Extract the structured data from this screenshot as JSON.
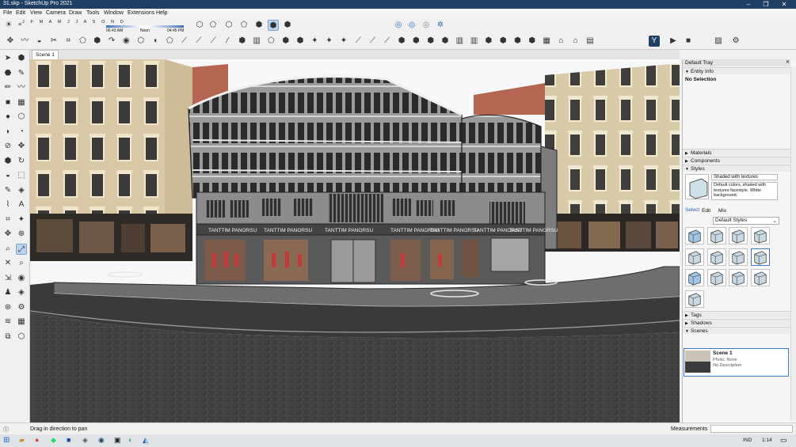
{
  "titlebar": {
    "title": "31.skp - SketchUp Pro 2021"
  },
  "menu": [
    "File",
    "Edit",
    "View",
    "Camera",
    "Draw",
    "Tools",
    "Window",
    "Extensions",
    "Help"
  ],
  "shadow": {
    "months": "J F M A M J J A S O N D",
    "sunrise": "06:43 AM",
    "noon": "Noon",
    "sunset": "04:45 PM"
  },
  "scene_tab": "Scene 1",
  "tray": {
    "title": "Default Tray",
    "entity_info": "Entity Info",
    "selection": "No Selection",
    "materials": "Materials",
    "components": "Components",
    "styles": "Styles",
    "style_name": "Shaded with textures",
    "style_desc": "Default colors, shaded with textures facestyle. White background.",
    "tab_select": "Select",
    "tab_edit": "Edit",
    "tab_mix": "Mix",
    "style_dropdown": "Default Styles",
    "tags": "Tags",
    "shadows": "Shadows",
    "scenes": "Scenes",
    "scene_name": "Scene 1",
    "scene_photo": "Photo: None",
    "scene_desc": "No Description"
  },
  "status": {
    "hint": "Drag in direction to pan",
    "measurements": "Measurements"
  },
  "taskbar": {
    "lang": "IND",
    "time": "1:14"
  },
  "signs": [
    "TANTTIM PANORSU",
    "TANTTIM PANORSU",
    "TANTTIM PANORSU",
    "TANTTIM PANORSU",
    "TANTTIM PANORSU",
    "TANTTIM PANORSU",
    "TANTTIM PANORSU"
  ],
  "colors": {
    "accent": "#3a78c8",
    "titlebar": "#1f3f63"
  }
}
